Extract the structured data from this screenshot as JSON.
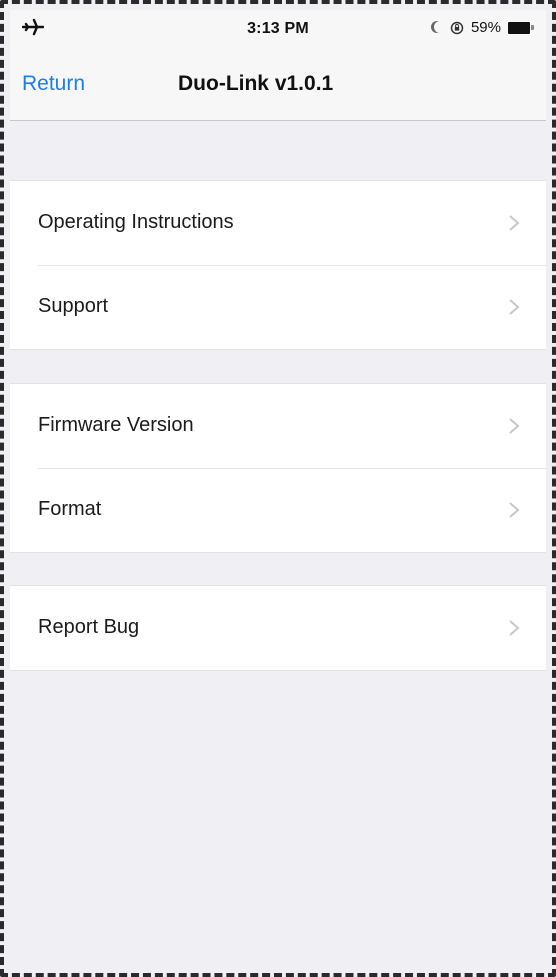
{
  "status_bar": {
    "time": "3:13 PM",
    "battery_percent": "59%",
    "battery_level": 0.59,
    "icons": [
      "airplane-icon",
      "moon-icon",
      "rotation-lock-icon",
      "battery-icon"
    ]
  },
  "nav": {
    "back_label": "Return",
    "title": "Duo-Link v1.0.1"
  },
  "groups": [
    {
      "rows": [
        {
          "label": "Operating Instructions"
        },
        {
          "label": "Support"
        }
      ]
    },
    {
      "rows": [
        {
          "label": "Firmware Version"
        },
        {
          "label": "Format"
        }
      ]
    },
    {
      "rows": [
        {
          "label": "Report Bug"
        }
      ]
    }
  ],
  "colors": {
    "accent": "#1a7ef1",
    "background": "#efeff4",
    "cell": "#ffffff",
    "chevron": "#c7c7cc"
  }
}
